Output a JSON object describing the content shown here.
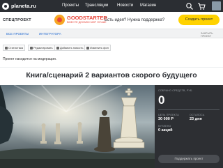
{
  "topnav": {
    "logo": "planeta.ru",
    "items": [
      "Проекты",
      "Трансляции",
      "Новости",
      "Магазин"
    ]
  },
  "subheader": {
    "special_label": "СПЕЦПРОЕКТ",
    "goodstarter_title": "GOODSTARTER",
    "goodstarter_sub": "ВМЕСТЕ ДЕЛАЕМ МИР ЛУЧШЕ",
    "question": "Есть идея? Нужна поддержка?",
    "create_button": "Создать проект"
  },
  "tabs": {
    "items": [
      "ВСЕ ПРОЕКТЫ",
      "ИНТЕГРАТОРА"
    ],
    "right_label": "ЗАКРЫТЬ ПРОЕКТ"
  },
  "toolbar": {
    "buttons": [
      "Статистика",
      "Редактировать",
      "Добавить новость",
      "Изменить фон"
    ]
  },
  "moderation_text": "Проект находится на модерации.",
  "project_title": "Книга/сценарий 2 вариантов скорого будущего",
  "panel": {
    "raised_label": "СОБРАНО СРЕДСТВ, РУБ.",
    "raised_value": "0",
    "goal_label": "ЦЕЛЬ ПРОЕКТА",
    "goal_value": "30 000 Р",
    "remaining_label": "ОСТАЛОСЬ",
    "remaining_value": "23 дня",
    "bought_label": "КУПЛЕНО",
    "bought_value": "0 акций",
    "progress": 0,
    "support_button": "Поддержать проект"
  },
  "colors": {
    "nav_bg": "#2b2e33",
    "accent_yellow": "#ffd200",
    "link_blue": "#2b6fd1",
    "goodstarter_red": "#e8463b"
  }
}
